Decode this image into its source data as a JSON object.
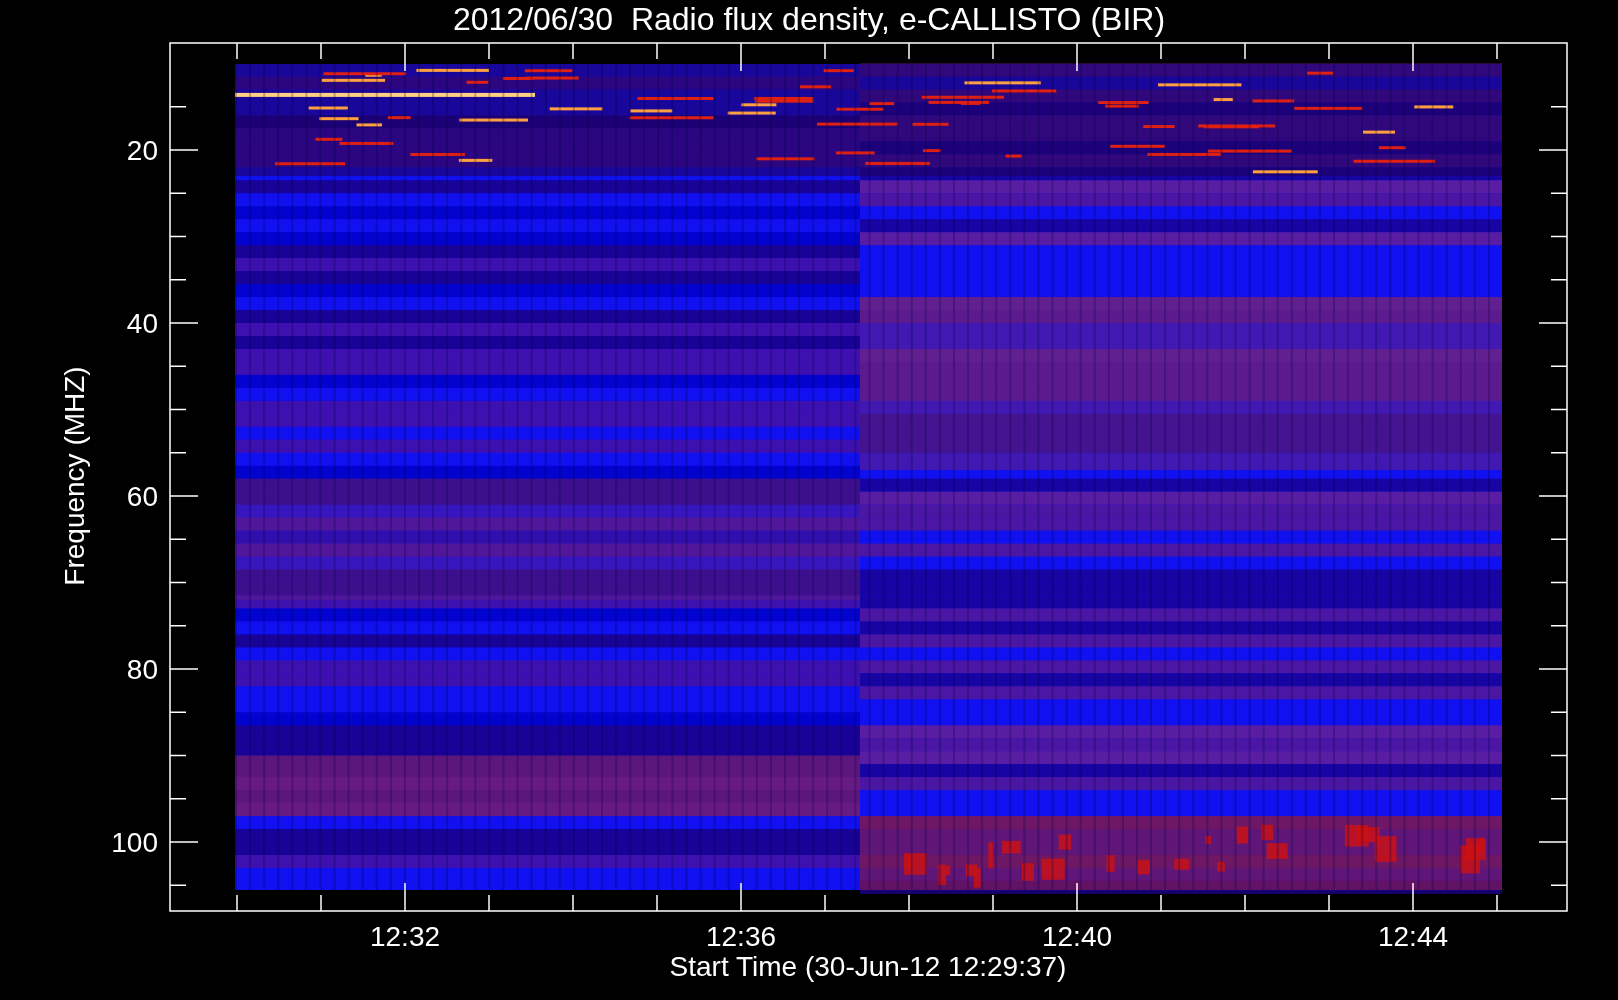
{
  "title": "2012/06/30  Radio flux density, e-CALLISTO (BIR)",
  "y_axis": {
    "label": "Frequency (MHZ)",
    "ticks": [
      "20",
      "40",
      "60",
      "80",
      "100"
    ]
  },
  "x_axis": {
    "label": "Start Time (30-Jun-12 12:29:37)",
    "ticks": [
      "12:32",
      "12:36",
      "12:40",
      "12:44"
    ]
  }
}
